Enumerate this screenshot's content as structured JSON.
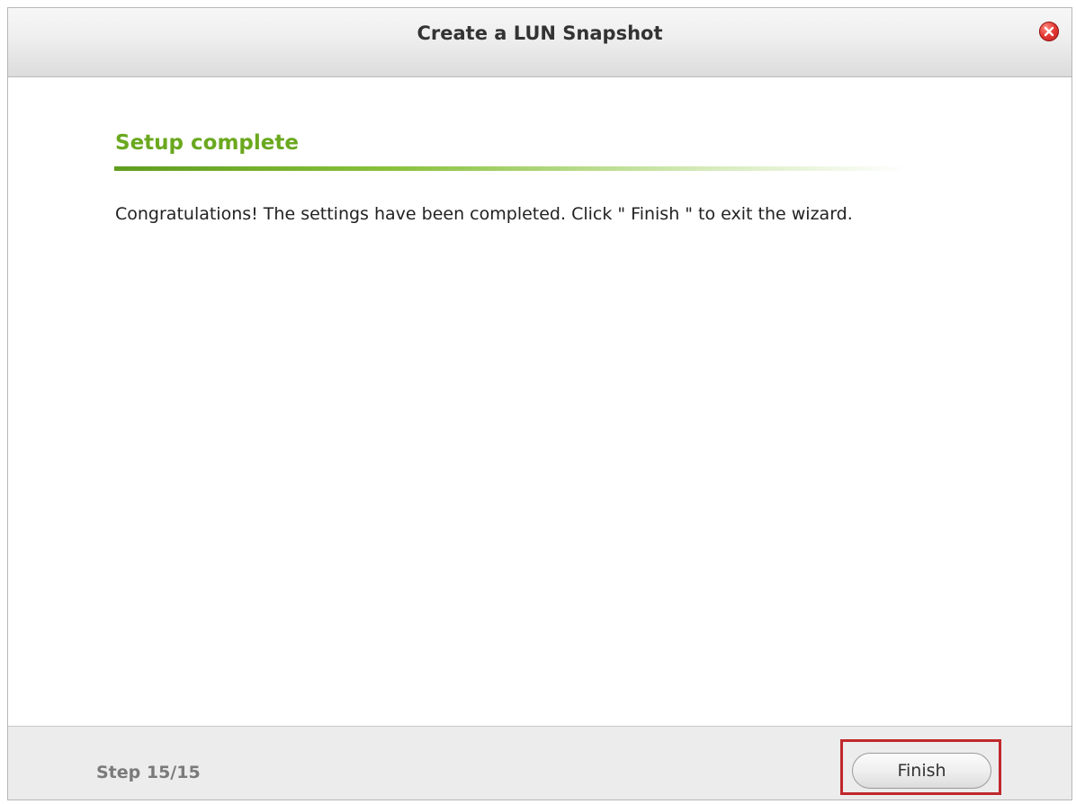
{
  "dialog": {
    "title": "Create a LUN Snapshot",
    "close_icon": "close-icon"
  },
  "content": {
    "section_title": "Setup complete",
    "message": "Congratulations! The settings have been completed. Click \" Finish \" to exit the wizard."
  },
  "footer": {
    "step_label": "Step 15/15",
    "finish_label": "Finish"
  },
  "colors": {
    "section_title": "#6aa81e",
    "highlight_box": "#c0282c",
    "close_button": "#e53935"
  }
}
